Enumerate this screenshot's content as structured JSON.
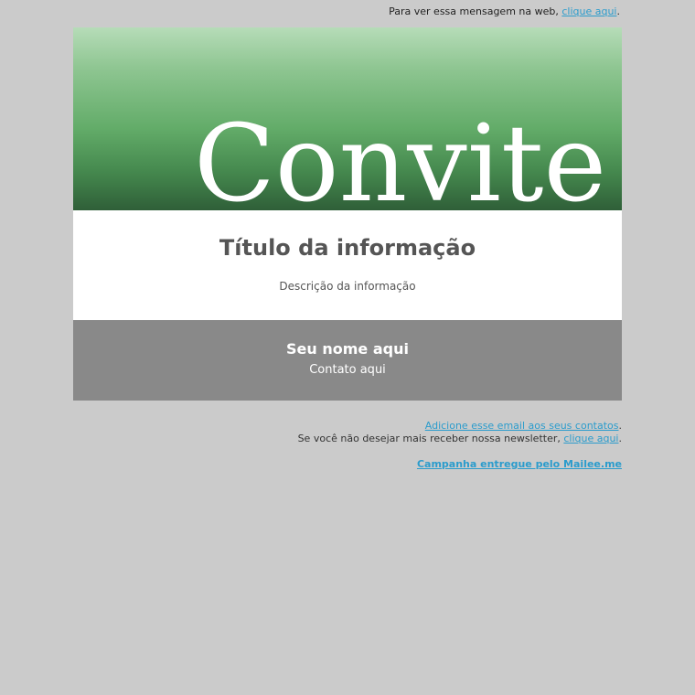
{
  "top_bar": {
    "text": "Para ver essa mensagem na web,",
    "link": "clique aqui",
    "punct": "."
  },
  "hero": {
    "title": "Convite",
    "gradient_colors": [
      "#b6dcb8",
      "#63ac69",
      "#2f5f38"
    ]
  },
  "info": {
    "title": "Título da informação",
    "description": "Descrição da informação"
  },
  "signature": {
    "name": "Seu nome aqui",
    "contact": "Contato aqui",
    "background": "#898989"
  },
  "footer": {
    "add_contacts_link": "Adicione esse email aos seus contatos",
    "add_contacts_punct": ".",
    "unsubscribe_text": "Se você não desejar mais receber nossa newsletter,",
    "unsubscribe_link": "clique aqui",
    "unsubscribe_punct": ".",
    "brand_link": "Campanha entregue pelo Mailee.me"
  },
  "colors": {
    "page_background": "#cbcbcb",
    "link": "#2b9ccc"
  }
}
